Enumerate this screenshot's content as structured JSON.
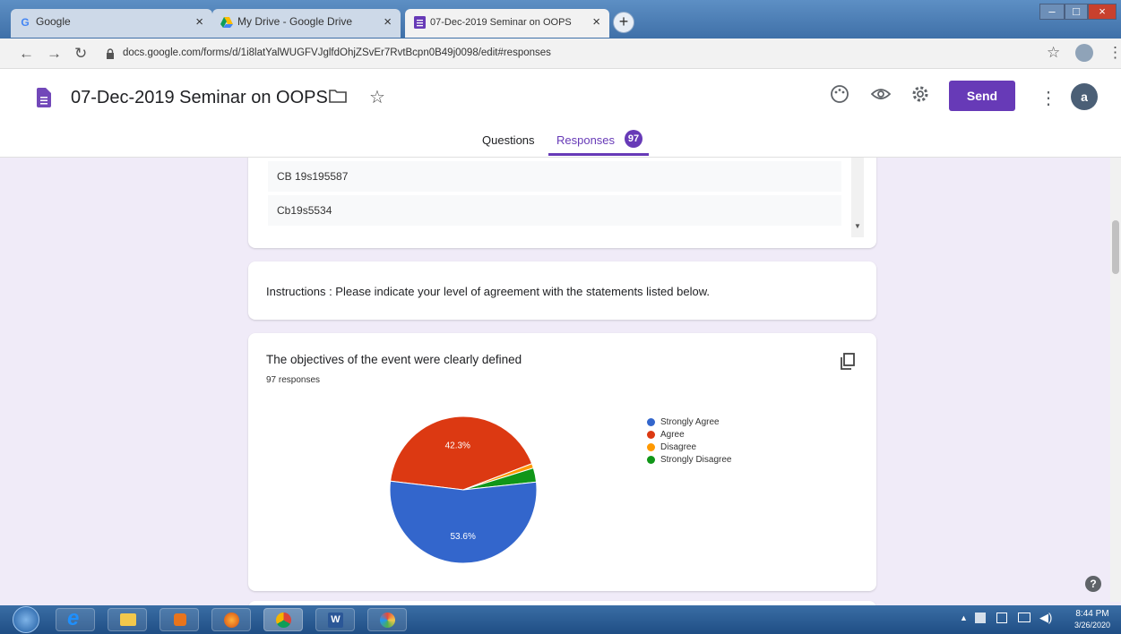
{
  "browser": {
    "tabs": [
      {
        "title": "Google",
        "icon": "G",
        "active": false
      },
      {
        "title": "My Drive - Google Drive",
        "icon": "drive-icon",
        "active": false
      },
      {
        "title": "07-Dec-2019 Seminar on OOPS",
        "icon": "forms-icon",
        "active": true
      }
    ],
    "url": "docs.google.com/forms/d/1i8latYalWUGFVJglfdOhjZSvEr7RvtBcpn0B49j0098/edit#responses"
  },
  "form": {
    "title": "07-Dec-2019 Seminar on OOPS",
    "send_label": "Send",
    "avatar_letter": "a",
    "tabs": {
      "questions": "Questions",
      "responses": "Responses"
    },
    "response_count": "97"
  },
  "previous_answers": [
    "CB 19s195587",
    "Cb19s5534"
  ],
  "instructions": "Instructions : Please indicate your level of agreement with the statements listed below.",
  "question": {
    "title": "The objectives of the event were clearly defined",
    "responses": "97 responses"
  },
  "chart_data": {
    "type": "pie",
    "slices": [
      {
        "label": "Strongly Agree",
        "value": 53.6,
        "color": "#3366cc",
        "data_label": "53.6%"
      },
      {
        "label": "Agree",
        "value": 42.3,
        "color": "#dc3912",
        "data_label": "42.3%"
      },
      {
        "label": "Disagree",
        "value": 1.0,
        "color": "#ff9900",
        "data_label": ""
      },
      {
        "label": "Strongly Disagree",
        "value": 3.1,
        "color": "#109618",
        "data_label": ""
      }
    ],
    "legend_position": "right"
  },
  "taskbar": {
    "time": "8:44 PM",
    "date": "3/26/2020"
  },
  "colors": {
    "accent": "#673ab7",
    "page_bg": "#f0ebf8"
  }
}
